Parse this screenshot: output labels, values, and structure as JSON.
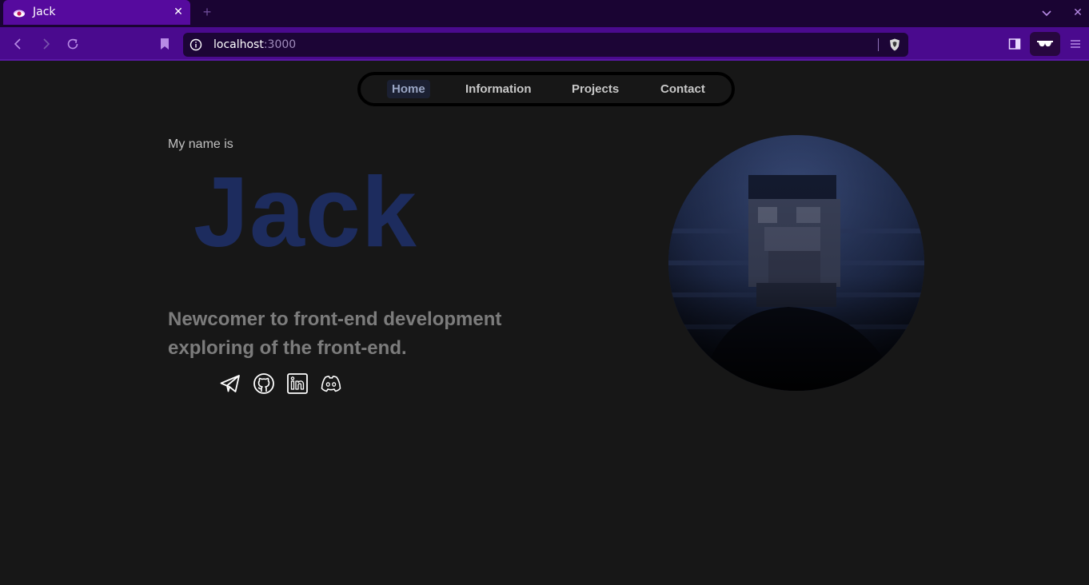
{
  "browser": {
    "tab": {
      "title": "Jack",
      "close_glyph": "✕",
      "favicon": "brave-eye-icon"
    },
    "new_tab_glyph": "+",
    "window_close_glyph": "✕",
    "url": {
      "host": "localhost",
      "port": ":3000"
    },
    "colors": {
      "tabstrip": "#1a0433",
      "active_tab": "#560a9e",
      "toolbar": "#4a0a8e",
      "urlbar": "#1c0536"
    }
  },
  "nav": {
    "items": [
      {
        "label": "Home",
        "active": true
      },
      {
        "label": "Information"
      },
      {
        "label": "Projects"
      },
      {
        "label": "Contact"
      }
    ]
  },
  "hero": {
    "intro": "My name is",
    "name": "Jack",
    "tagline": "Newcomer to front-end development exploring of the front-end.",
    "name_color": "#1d2c5e"
  },
  "socials": [
    {
      "icon": "telegram-icon"
    },
    {
      "icon": "github-icon"
    },
    {
      "icon": "linkedin-icon"
    },
    {
      "icon": "discord-icon"
    }
  ],
  "avatar": {
    "icon": "profile-photo"
  }
}
